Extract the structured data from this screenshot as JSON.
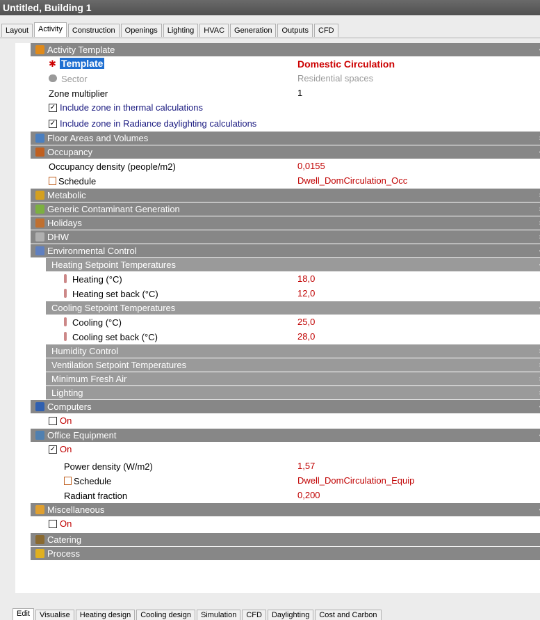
{
  "title": "Untitled, Building 1",
  "top_tabs": [
    "Layout",
    "Activity",
    "Construction",
    "Openings",
    "Lighting",
    "HVAC",
    "Generation",
    "Outputs",
    "CFD"
  ],
  "active_top_tab": "Activity",
  "sections": {
    "activity_template": {
      "header": "Activity Template",
      "template_label": "Template",
      "template_value": "Domestic Circulation",
      "sector_label": "Sector",
      "sector_value": "Residential spaces",
      "zone_multiplier_label": "Zone multiplier",
      "zone_multiplier_value": "1",
      "thermal_label": "Include zone in thermal calculations",
      "radiance_label": "Include zone in Radiance daylighting calculations"
    },
    "floor_areas": {
      "header": "Floor Areas and Volumes"
    },
    "occupancy": {
      "header": "Occupancy",
      "density_label": "Occupancy density (people/m2)",
      "density_value": "0,0155",
      "schedule_label": "Schedule",
      "schedule_value": "Dwell_DomCirculation_Occ"
    },
    "metabolic": {
      "header": "Metabolic"
    },
    "contaminant": {
      "header": "Generic Contaminant Generation"
    },
    "holidays": {
      "header": "Holidays"
    },
    "dhw": {
      "header": "DHW"
    },
    "environmental": {
      "header": "Environmental Control",
      "heating_header": "Heating Setpoint Temperatures",
      "heating_label": "Heating (°C)",
      "heating_value": "18,0",
      "heating_setback_label": "Heating set back (°C)",
      "heating_setback_value": "12,0",
      "cooling_header": "Cooling Setpoint Temperatures",
      "cooling_label": "Cooling (°C)",
      "cooling_value": "25,0",
      "cooling_setback_label": "Cooling set back (°C)",
      "cooling_setback_value": "28,0",
      "humidity_header": "Humidity Control",
      "ventilation_header": "Ventilation Setpoint Temperatures",
      "fresh_air_header": "Minimum Fresh Air",
      "lighting_header": "Lighting"
    },
    "computers": {
      "header": "Computers",
      "on_label": "On",
      "checked": false
    },
    "office_equipment": {
      "header": "Office Equipment",
      "on_label": "On",
      "checked": true,
      "power_label": "Power density (W/m2)",
      "power_value": "1,57",
      "schedule_label": "Schedule",
      "schedule_value": "Dwell_DomCirculation_Equip",
      "radiant_label": "Radiant fraction",
      "radiant_value": "0,200"
    },
    "miscellaneous": {
      "header": "Miscellaneous",
      "on_label": "On",
      "checked": false
    },
    "catering": {
      "header": "Catering"
    },
    "process": {
      "header": "Process"
    }
  },
  "bottom_tabs": [
    "Edit",
    "Visualise",
    "Heating design",
    "Cooling design",
    "Simulation",
    "CFD",
    "Daylighting",
    "Cost and Carbon"
  ],
  "active_bottom_tab": "Edit",
  "colors": {
    "header_bg": "#878787",
    "value_red": "#c00000",
    "template_highlight": "#1f6fd1",
    "link_blue": "#1a1a80"
  }
}
